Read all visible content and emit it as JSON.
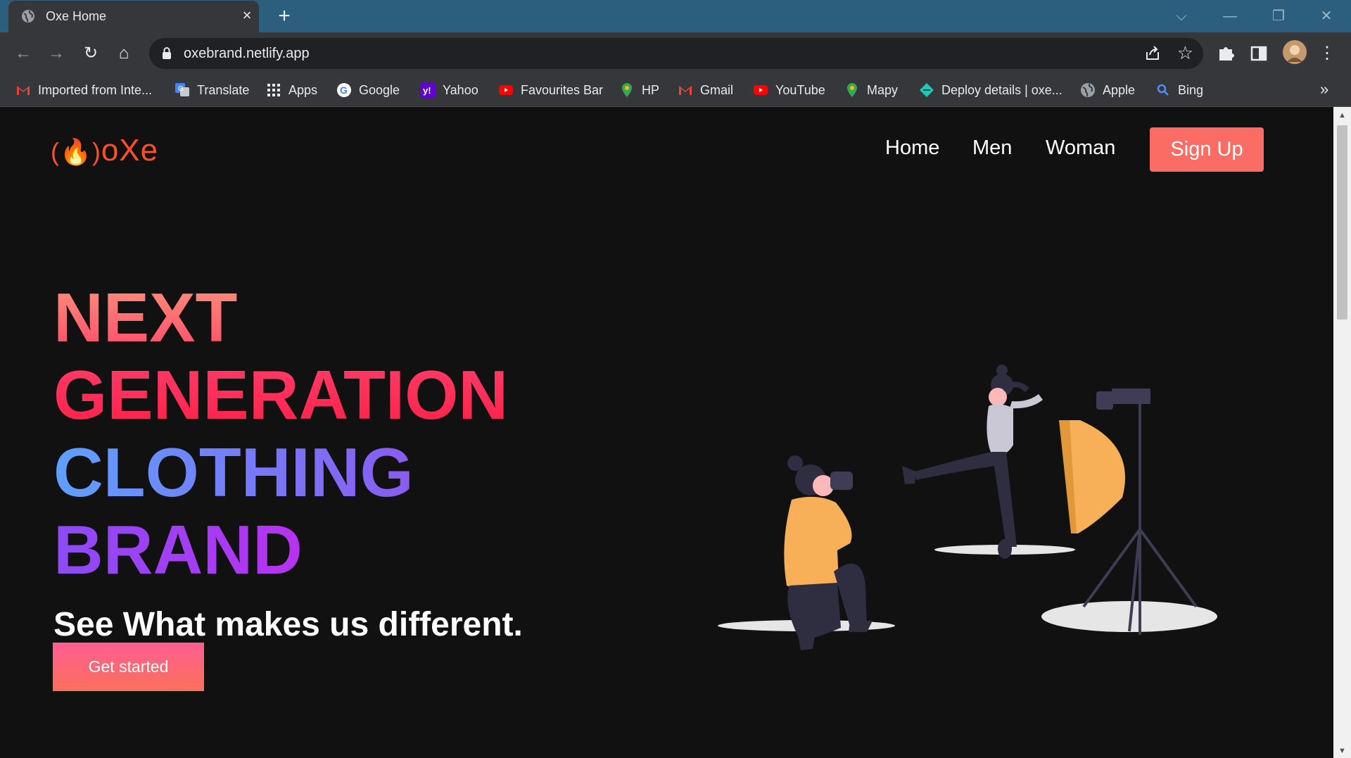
{
  "browser": {
    "tab": {
      "title": "Oxe Home",
      "close_glyph": "×"
    },
    "new_tab_glyph": "+",
    "window_controls": {
      "dropdown": "⌵",
      "minimize": "—",
      "maximize": "❐",
      "close": "✕"
    },
    "nav": {
      "back": "←",
      "forward": "→",
      "reload": "↻",
      "home": "⌂"
    },
    "address": {
      "url": "oxebrand.netlify.app"
    },
    "star_glyph": "☆",
    "menu_glyph": "⋮",
    "bookmarks": [
      {
        "label": "Imported from Inte...",
        "icon": "gmail-icon",
        "color": "#ea4335"
      },
      {
        "label": "Translate",
        "icon": "google-translate-icon",
        "color": "#4285f4"
      },
      {
        "label": "Apps",
        "icon": "apps-grid-icon",
        "color": "#e8eaed"
      },
      {
        "label": "Google",
        "icon": "google-icon",
        "color": "#ffffff"
      },
      {
        "label": "Yahoo",
        "icon": "yahoo-icon",
        "color": "#6001d2"
      },
      {
        "label": "Favourites Bar",
        "icon": "youtube-icon",
        "color": "#ff0000"
      },
      {
        "label": "HP",
        "icon": "maps-pin-icon",
        "color": "#34a853"
      },
      {
        "label": "Gmail",
        "icon": "gmail-icon",
        "color": "#ea4335"
      },
      {
        "label": "YouTube",
        "icon": "youtube-icon",
        "color": "#ff0000"
      },
      {
        "label": "Mapy",
        "icon": "maps-pin-icon",
        "color": "#34a853"
      },
      {
        "label": "Deploy details | oxe...",
        "icon": "netlify-icon",
        "color": "#20c6b7"
      },
      {
        "label": "Apple",
        "icon": "globe-icon",
        "color": "#9aa0a6"
      },
      {
        "label": "Bing",
        "icon": "search-icon",
        "color": "#4f8ff7"
      }
    ],
    "bookmarks_more": "»"
  },
  "site": {
    "logo": {
      "flame": "(🔥)",
      "text": "oXe",
      "color": "#ff4f25"
    },
    "nav": {
      "home": "Home",
      "men": "Men",
      "woman": "Woman",
      "signup": "Sign Up"
    },
    "hero": {
      "line1": "NEXT",
      "line2": "GENERATION",
      "line3": "CLOTHING",
      "line4": "BRAND",
      "subtitle": "See What makes us different.",
      "cta": "Get started"
    },
    "accent_color": "#fa6c64"
  },
  "scrollbar": {
    "up": "▲",
    "down": "▼"
  }
}
